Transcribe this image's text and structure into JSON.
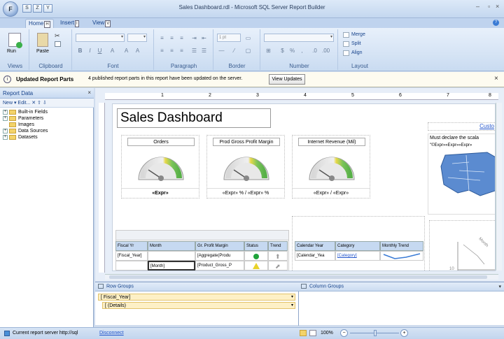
{
  "title_bar": {
    "title": "Sales Dashboard.rdl - Microsoft SQL Server Report Builder",
    "app_key": "F",
    "qa": [
      "S",
      "Z",
      "Y"
    ],
    "minimize": "–",
    "close": "×"
  },
  "tabs": [
    {
      "label": "Home",
      "key": "H"
    },
    {
      "label": "Insert",
      "key": "I"
    },
    {
      "label": "View",
      "key": "V"
    }
  ],
  "ribbon": {
    "groups": [
      "Views",
      "Clipboard",
      "Font",
      "Paragraph",
      "Border",
      "Number",
      "Layout"
    ],
    "run_label": "Run",
    "paste_label": "Paste",
    "border_width": "1 pt",
    "merge_label": "Merge",
    "split_label": "Split",
    "align_label": "Align"
  },
  "infobar": {
    "title": "Updated Report Parts",
    "message": "4 published report parts in this report have been updated on the server.",
    "button": "View Updates",
    "close": "×"
  },
  "report_data": {
    "title": "Report Data",
    "close": "×",
    "toolbar": "New ▾  Edit...  ✕  ⇧  ⇩",
    "items": [
      "Built-in Fields",
      "Parameters",
      "Images",
      "Data Sources",
      "Datasets"
    ]
  },
  "ruler": [
    "1",
    "2",
    "3",
    "4",
    "5",
    "6",
    "7",
    "8"
  ],
  "report": {
    "title": "Sales Dashboard",
    "custom_label": "Custo",
    "map_text": "Must declare the scala",
    "map_expr": "\"©Expr»«Expr»«Expr»",
    "gauges": [
      {
        "title": "Orders",
        "foot": "«Expr»"
      },
      {
        "title": "Prod Gross Profit Margin",
        "foot": "«Expr» % / «Expr» %"
      },
      {
        "title": "Internet Revenue (Mil)",
        "foot": "«Expr» / «Expr»"
      }
    ],
    "table_headers": [
      "Fiscal Yr",
      "Month",
      "Gr. Profit Margin",
      "Status",
      "Trend"
    ],
    "table_row1": [
      "[Fiscal_Year]",
      "",
      "[Aggregate(Produ"
    ],
    "table_row2": [
      "",
      "[Month]",
      "[Product_Gross_P"
    ],
    "matrix_headers": [
      "Calendar Year",
      "Category",
      "Monthly Trend"
    ],
    "matrix_row": [
      "[Calendar_Yea",
      "[Category]"
    ],
    "chart_label": "Month",
    "chart_tick": "10"
  },
  "row_groups": {
    "title": "Row Groups",
    "items": [
      "[ Fiscal_Year]",
      "[ (Details)"
    ]
  },
  "column_groups": {
    "title": "Column Groups"
  },
  "status": {
    "server": "Current report server http://sql",
    "disconnect": "Disconnect",
    "zoom": "100%",
    "minus": "−",
    "plus": "+"
  }
}
